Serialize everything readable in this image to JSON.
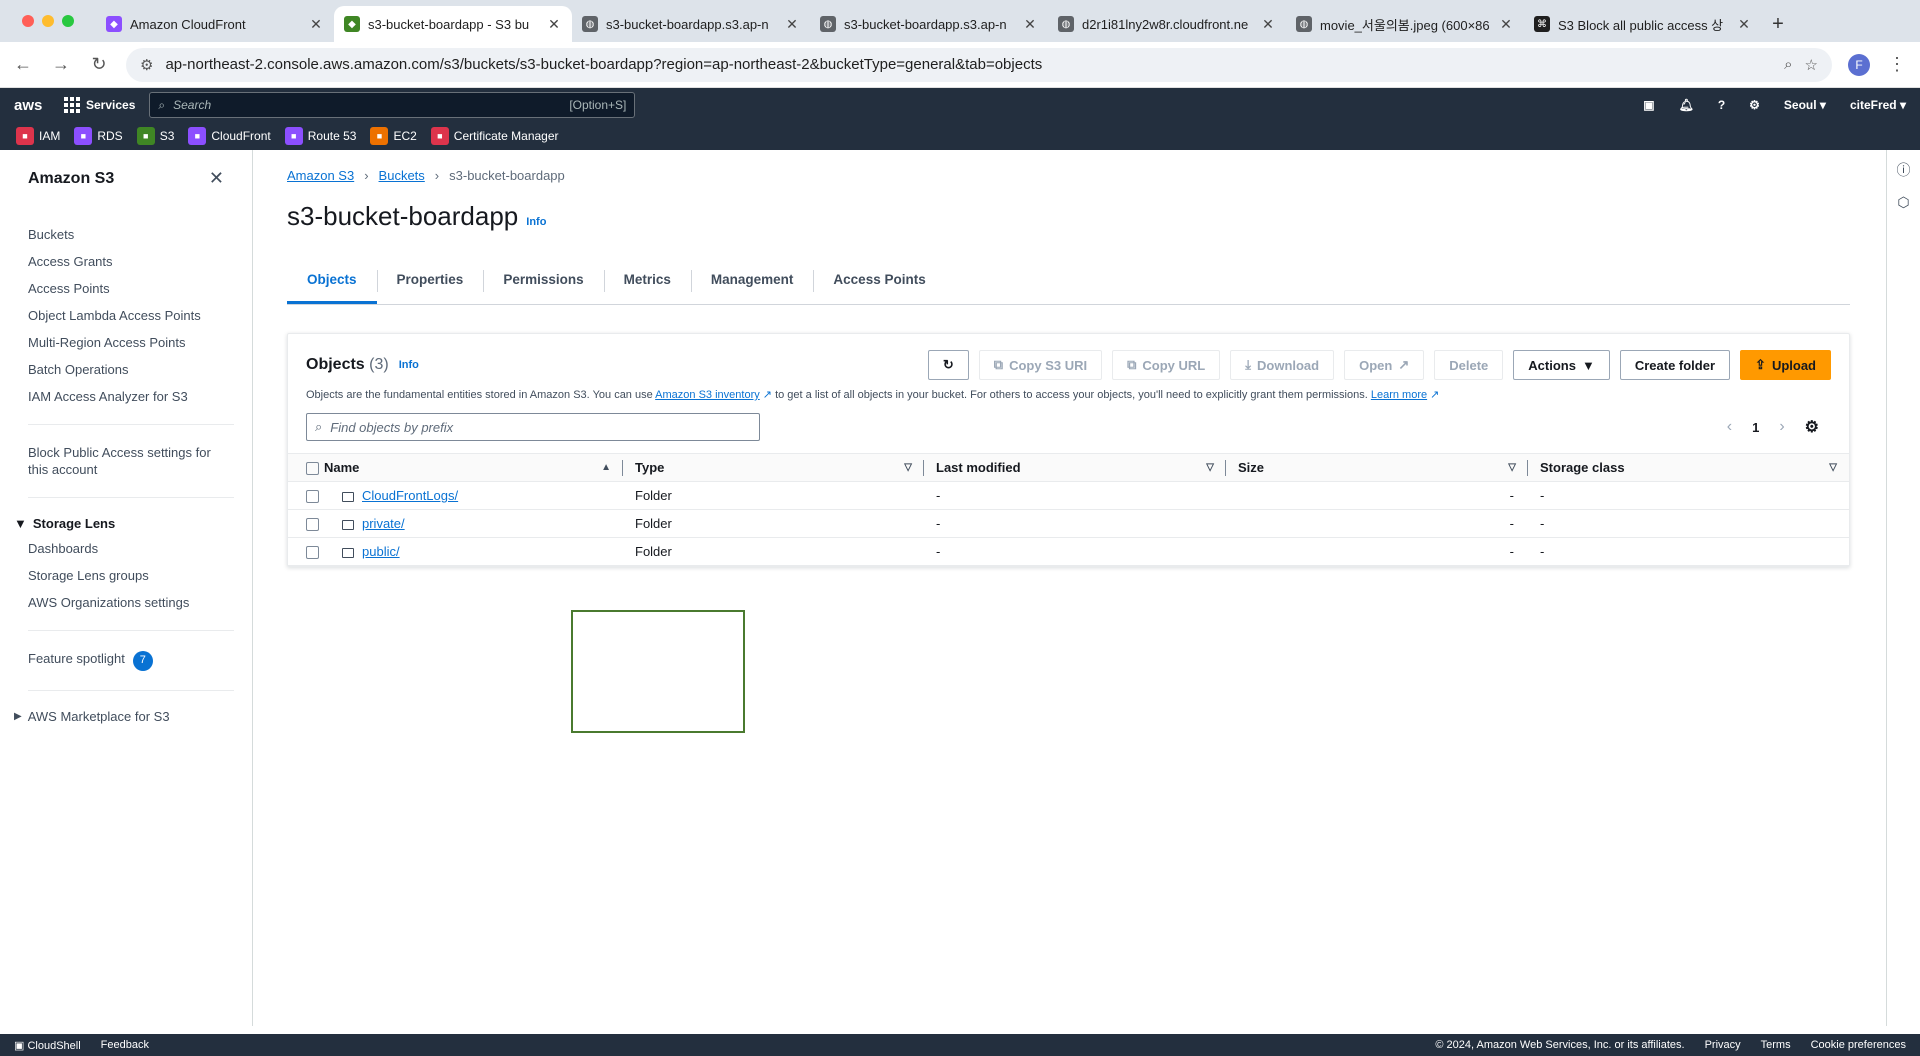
{
  "browser": {
    "tabs": [
      {
        "title": "Amazon CloudFront",
        "icon": "cloudfront-icon",
        "color": "#8c4fff",
        "active": false
      },
      {
        "title": "s3-bucket-boardapp - S3 bu",
        "icon": "s3-icon",
        "color": "#3f8624",
        "active": true
      },
      {
        "title": "s3-bucket-boardapp.s3.ap-n",
        "icon": "globe-icon",
        "color": "#5f6368",
        "active": false
      },
      {
        "title": "s3-bucket-boardapp.s3.ap-n",
        "icon": "globe-icon",
        "color": "#5f6368",
        "active": false
      },
      {
        "title": "d2r1i81lny2w8r.cloudfront.ne",
        "icon": "globe-icon",
        "color": "#5f6368",
        "active": false
      },
      {
        "title": "movie_서울의봄.jpeg (600×86",
        "icon": "globe-icon",
        "color": "#5f6368",
        "active": false
      },
      {
        "title": "S3 Block all public access 상",
        "icon": "command-icon",
        "color": "#1f1f1f",
        "active": false
      }
    ],
    "url": "ap-northeast-2.console.aws.amazon.com/s3/buckets/s3-bucket-boardapp?region=ap-northeast-2&bucketType=general&tab=objects",
    "avatar_letter": "F"
  },
  "aws_nav": {
    "logo": "aws",
    "services_label": "Services",
    "search_placeholder": "Search",
    "search_shortcut": "[Option+S]",
    "region": "Seoul",
    "account": "citeFred",
    "favorites": [
      {
        "label": "IAM",
        "color": "#dd344c"
      },
      {
        "label": "RDS",
        "color": "#8c4fff"
      },
      {
        "label": "S3",
        "color": "#3f8624"
      },
      {
        "label": "CloudFront",
        "color": "#8c4fff"
      },
      {
        "label": "Route 53",
        "color": "#8c4fff"
      },
      {
        "label": "EC2",
        "color": "#ed7100"
      },
      {
        "label": "Certificate Manager",
        "color": "#dd344c"
      }
    ]
  },
  "sidebar": {
    "title": "Amazon S3",
    "items": [
      "Buckets",
      "Access Grants",
      "Access Points",
      "Object Lambda Access Points",
      "Multi-Region Access Points",
      "Batch Operations",
      "IAM Access Analyzer for S3"
    ],
    "block_public": "Block Public Access settings for this account",
    "storage_lens_title": "Storage Lens",
    "storage_lens_items": [
      "Dashboards",
      "Storage Lens groups",
      "AWS Organizations settings"
    ],
    "feature_spotlight": "Feature spotlight",
    "feature_count": "7",
    "marketplace": "AWS Marketplace for S3"
  },
  "breadcrumb": {
    "root": "Amazon S3",
    "buckets": "Buckets",
    "current": "s3-bucket-boardapp"
  },
  "page": {
    "title": "s3-bucket-boardapp",
    "info": "Info"
  },
  "tabs": [
    "Objects",
    "Properties",
    "Permissions",
    "Metrics",
    "Management",
    "Access Points"
  ],
  "objects_panel": {
    "title": "Objects",
    "count": "(3)",
    "info": "Info",
    "buttons": {
      "copy_s3_uri": "Copy S3 URI",
      "copy_url": "Copy URL",
      "download": "Download",
      "open": "Open",
      "delete": "Delete",
      "actions": "Actions",
      "create_folder": "Create folder",
      "upload": "Upload"
    },
    "description_before": "Objects are the fundamental entities stored in Amazon S3. You can use ",
    "inventory_link": "Amazon S3 inventory",
    "description_after": " to get a list of all objects in your bucket. For others to access your objects, you'll need to explicitly grant them permissions. ",
    "learn_more": "Learn more",
    "filter_placeholder": "Find objects by prefix",
    "page_number": "1",
    "columns": [
      "Name",
      "Type",
      "Last modified",
      "Size",
      "Storage class"
    ],
    "rows": [
      {
        "name": "CloudFrontLogs/",
        "type": "Folder",
        "last_modified": "-",
        "size": "-",
        "storage_class": "-"
      },
      {
        "name": "private/",
        "type": "Folder",
        "last_modified": "-",
        "size": "-",
        "storage_class": "-"
      },
      {
        "name": "public/",
        "type": "Folder",
        "last_modified": "-",
        "size": "-",
        "storage_class": "-"
      }
    ]
  },
  "footer": {
    "cloudshell": "CloudShell",
    "feedback": "Feedback",
    "copyright": "© 2024, Amazon Web Services, Inc. or its affiliates.",
    "privacy": "Privacy",
    "terms": "Terms",
    "cookie": "Cookie preferences"
  }
}
